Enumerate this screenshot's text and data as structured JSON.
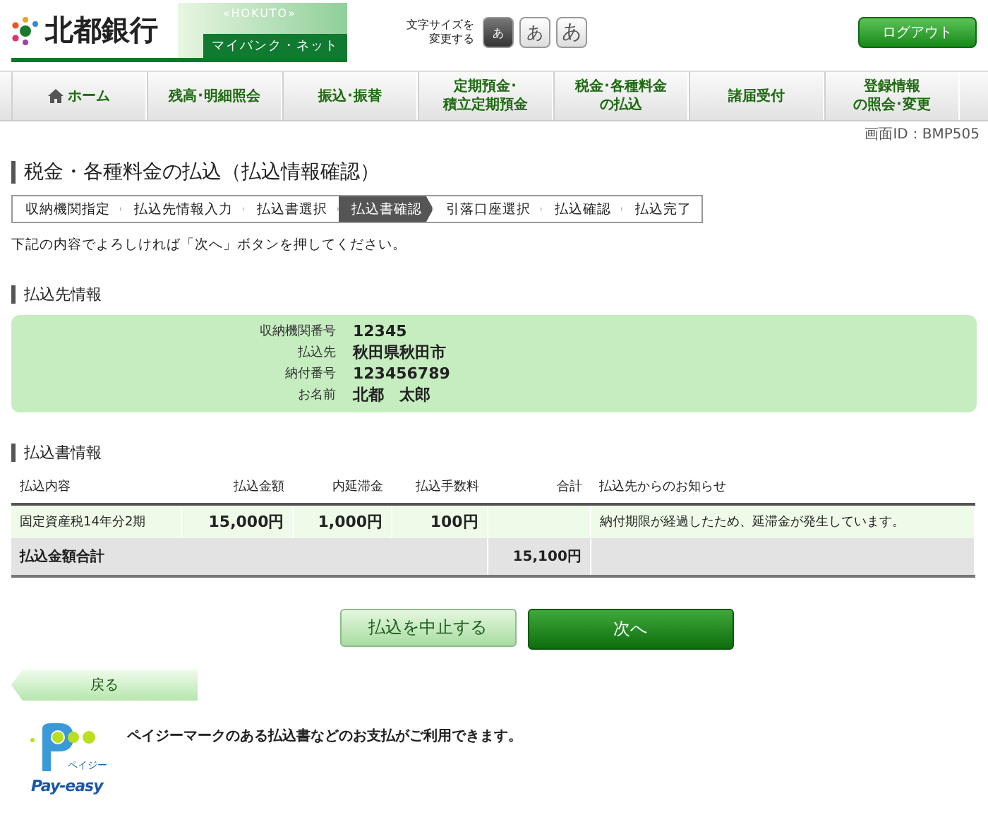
{
  "header": {
    "logo": {
      "name": "北都銀行",
      "tag": "«HOKUTO»",
      "service": "マイバンク・ネット"
    },
    "font_size": {
      "label": "文字サイズを変更する",
      "options": [
        {
          "label": "あ",
          "selected": true
        },
        {
          "label": "あ",
          "selected": false
        },
        {
          "label": "あ",
          "selected": false
        }
      ]
    },
    "logout": "ログアウト"
  },
  "nav": [
    {
      "lines": [
        "ホーム"
      ],
      "kind": "home"
    },
    {
      "lines": [
        "残高･明細照会"
      ],
      "kind": "text"
    },
    {
      "lines": [
        "振込･振替"
      ],
      "kind": "text"
    },
    {
      "lines": [
        "定期預金･",
        "積立定期預金"
      ],
      "kind": "text"
    },
    {
      "lines": [
        "税金･各種料金",
        "の払込"
      ],
      "kind": "text"
    },
    {
      "lines": [
        "諸届受付"
      ],
      "kind": "text"
    },
    {
      "lines": [
        "登録情報",
        "の照会･変更"
      ],
      "kind": "text"
    }
  ],
  "screen_id": "画面ID：BMP505",
  "page_title": "税金・各種料金の払込（払込情報確認）",
  "steps": [
    {
      "label": "収納機関指定",
      "selected": false
    },
    {
      "label": "払込先情報入力",
      "selected": false
    },
    {
      "label": "払込書選択",
      "selected": false
    },
    {
      "label": "払込書確認",
      "selected": true
    },
    {
      "label": "引落口座選択",
      "selected": false
    },
    {
      "label": "払込確認",
      "selected": false
    },
    {
      "label": "払込完了",
      "selected": false
    }
  ],
  "instruction": "下記の内容でよろしければ「次へ」ボタンを押してください。",
  "payee_section": {
    "heading": "払込先情報",
    "fields": [
      {
        "label": "収納機関番号",
        "value": "12345"
      },
      {
        "label": "払込先",
        "value": "秋田県秋田市"
      },
      {
        "label": "納付番号",
        "value": "123456789"
      },
      {
        "label": "お名前",
        "value": "北都　太郎"
      }
    ]
  },
  "bill_section": {
    "heading": "払込書情報",
    "table": {
      "columns": [
        "払込内容",
        "払込金額",
        "内延滞金",
        "払込手数料",
        "合計",
        "払込先からのお知らせ"
      ],
      "rows": [
        [
          "固定資産税14年分2期",
          "15,000円",
          "1,000円",
          "100円",
          "",
          "納付期限が経過したため、延滞金が発生しています。"
        ]
      ],
      "total": {
        "label": "払込金額合計",
        "value": "15,100円"
      }
    }
  },
  "buttons": {
    "cancel": "払込を中止する",
    "next": "次へ",
    "back": "戻る"
  },
  "payeasy": {
    "logo_kana": "ペイジー",
    "logo_text": "Pay-easy",
    "message": "ペイジーマークのある払込書などのお支払がご利用できます。"
  }
}
